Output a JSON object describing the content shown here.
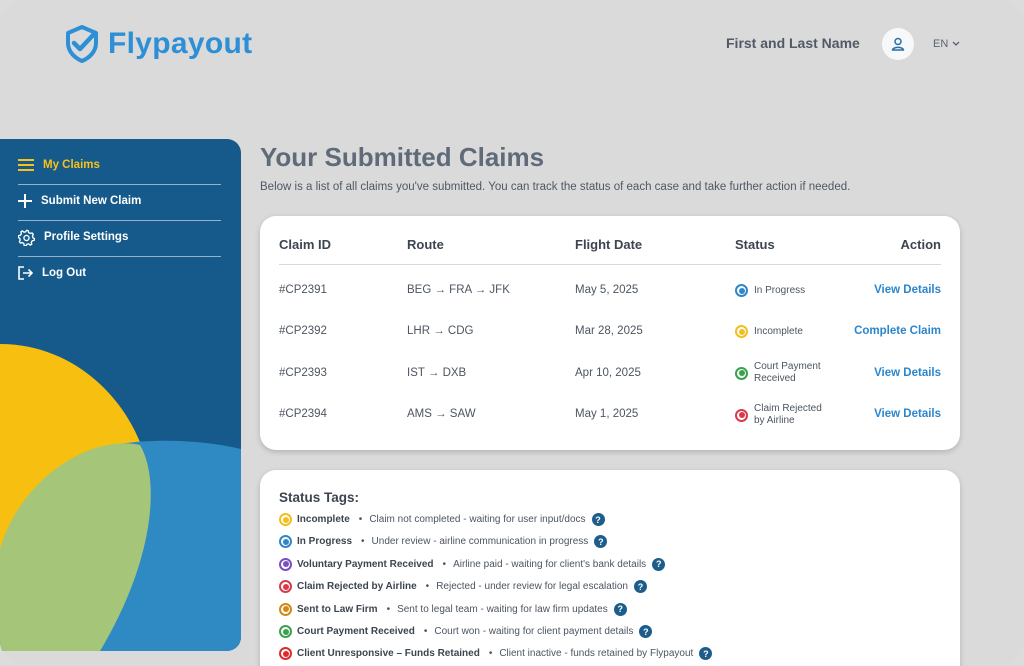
{
  "header": {
    "brand": "Flypayout",
    "user_name": "First and Last Name",
    "language": "EN"
  },
  "sidebar": {
    "items": [
      {
        "label": "My Claims",
        "icon": "menu-icon",
        "active": true
      },
      {
        "label": "Submit New Claim",
        "icon": "plus-icon",
        "active": false
      },
      {
        "label": "Profile Settings",
        "icon": "gear-icon",
        "active": false
      },
      {
        "label": "Log Out",
        "icon": "logout-icon",
        "active": false
      }
    ]
  },
  "main": {
    "title": "Your Submitted Claims",
    "subtitle": "Below is a list of all claims you've submitted. You can track the status of each case and take further action if needed."
  },
  "claims_table": {
    "headers": [
      "Claim ID",
      "Route",
      "Flight Date",
      "Status",
      "Action"
    ],
    "rows": [
      {
        "id": "#CP2391",
        "route": "BEG → FRA → JFK",
        "date": "May 5, 2025",
        "status": "In Progress",
        "status_color": "#2f86c9",
        "action": "View Details"
      },
      {
        "id": "#CP2392",
        "route": "LHR → CDG",
        "date": "Mar 28, 2025",
        "status": "Incomplete",
        "status_color": "#f2bf1d",
        "action": "Complete Claim"
      },
      {
        "id": "#CP2393",
        "route": "IST → DXB",
        "date": "Apr 10, 2025",
        "status": "Court Payment Received",
        "status_color": "#3aa24a",
        "action": "View Details"
      },
      {
        "id": "#CP2394",
        "route": "AMS → SAW",
        "date": "May 1, 2025",
        "status": "Claim Rejected by Airline",
        "status_color": "#d83a4a",
        "action": "View Details"
      }
    ]
  },
  "status_tags": {
    "title": "Status Tags:",
    "items": [
      {
        "name": "Incomplete",
        "desc": "Claim not completed - waiting for user input/docs",
        "color": "#f2bf1d"
      },
      {
        "name": "In Progress",
        "desc": "Under review - airline communication in progress",
        "color": "#2f86c9"
      },
      {
        "name": "Voluntary Payment Received",
        "desc": "Airline paid - waiting for client's bank details",
        "color": "#7a4fc0"
      },
      {
        "name": "Claim Rejected by Airline",
        "desc": "Rejected - under review for legal escalation",
        "color": "#d83a4a"
      },
      {
        "name": "Sent to Law Firm",
        "desc": "Sent to legal team - waiting for law firm updates",
        "color": "#d28a16"
      },
      {
        "name": "Court Payment Received",
        "desc": "Court won - waiting for client payment details",
        "color": "#3aa24a"
      },
      {
        "name": "Client Unresponsive – Funds Retained",
        "desc": "Client inactive - funds retained by Flypayout",
        "color": "#e02b2b"
      }
    ],
    "bullet": "•",
    "help_glyph": "?"
  },
  "colors": {
    "brand_blue": "#2d8fd5",
    "sidebar_bg": "#155a8a",
    "active_nav": "#f8c21a",
    "link": "#2a86cc"
  }
}
